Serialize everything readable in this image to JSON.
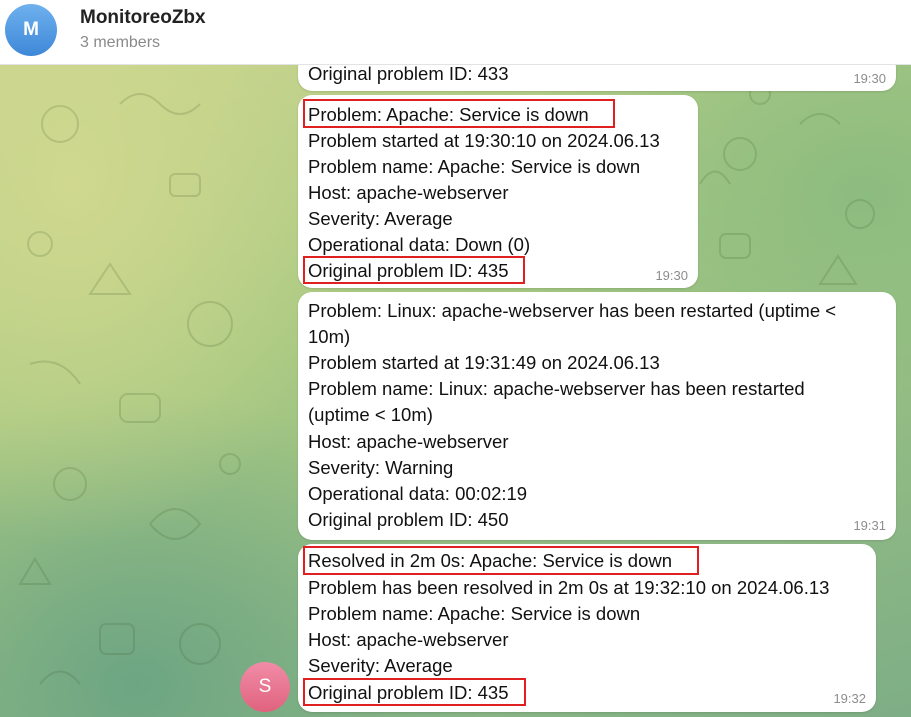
{
  "header": {
    "avatar_letter": "M",
    "title": "MonitoreoZbx",
    "subtitle": "3 members"
  },
  "sender_avatar_letter": "S",
  "messages": [
    {
      "lines": [
        "Original problem ID: 433"
      ],
      "time": "19:30"
    },
    {
      "lines": [
        "Problem: Apache: Service is down",
        "Problem started at 19:30:10 on 2024.06.13",
        "Problem name: Apache: Service is down",
        "Host: apache-webserver",
        "Severity: Average",
        "Operational data: Down (0)",
        "Original problem ID: 435"
      ],
      "time": "19:30"
    },
    {
      "lines": [
        "Problem: Linux: apache-webserver has been restarted (uptime <",
        "10m)",
        "Problem started at 19:31:49 on 2024.06.13",
        "Problem name: Linux: apache-webserver has been restarted",
        "(uptime < 10m)",
        "Host: apache-webserver",
        "Severity: Warning",
        "Operational data: 00:02:19",
        "Original problem ID: 450"
      ],
      "time": "19:31"
    },
    {
      "lines": [
        "Resolved in 2m 0s: Apache: Service is down",
        "Problem has been resolved in 2m 0s at 19:32:10 on 2024.06.13",
        "Problem name: Apache: Service is down",
        "Host: apache-webserver",
        "Severity: Average",
        "Original problem ID: 435"
      ],
      "time": "19:32"
    }
  ],
  "colors": {
    "highlight": "#e02020",
    "bubble": "#ffffff"
  }
}
